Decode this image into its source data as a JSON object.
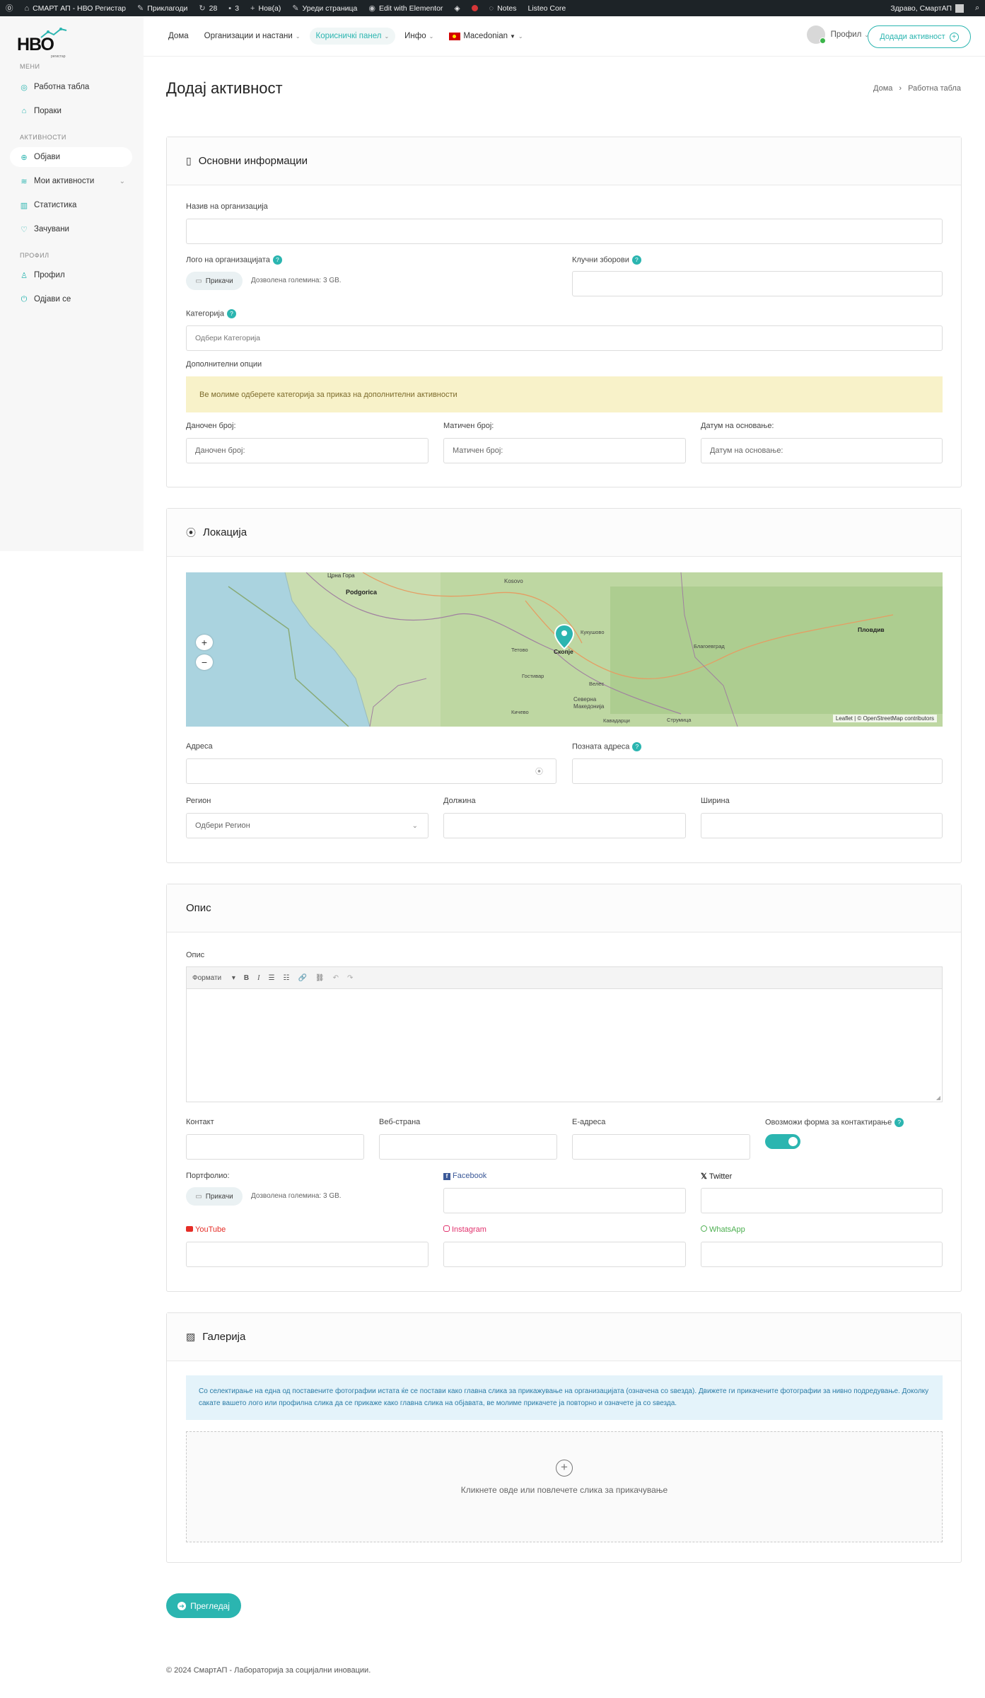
{
  "adminbar": {
    "site": "СМАРТ АП - НВО Регистар",
    "plugins": "Приклагоди",
    "updates": "28",
    "comments": "3",
    "new": "Нов(а)",
    "edit_page": "Уреди страница",
    "elementor": "Edit with Elementor",
    "notes": "Notes",
    "listeo": "Listeo Core",
    "greeting": "Здраво, СмартАП"
  },
  "logo": {
    "text": "НВО",
    "sub": "регистар"
  },
  "sidebar": {
    "sec_menu": "МЕНИ",
    "sec_activities": "АКТИВНОСТИ",
    "sec_profile": "ПРОФИЛ",
    "items": [
      {
        "label": "Работна табла"
      },
      {
        "label": "Пораки"
      },
      {
        "label": "Објави"
      },
      {
        "label": "Мои активности"
      },
      {
        "label": "Статистика"
      },
      {
        "label": "Зачувани"
      },
      {
        "label": "Профил"
      },
      {
        "label": "Одјави се"
      }
    ]
  },
  "topnav": {
    "items": [
      {
        "label": "Дома"
      },
      {
        "label": "Организации и настани"
      },
      {
        "label": "Корисничкi панел"
      },
      {
        "label": "Инфо"
      },
      {
        "label": "Macedonian"
      }
    ],
    "profile": "Профил",
    "add_button": "Додади активност"
  },
  "page": {
    "title": "Додај активност",
    "breadcrumb_home": "Дома",
    "breadcrumb_current": "Работна табла"
  },
  "basic": {
    "title": "Основни информации",
    "org_name_label": "Назив на организација",
    "logo_label": "Лого на организацијата",
    "attach": "Прикачи",
    "size_note": "Дозволена големина: 3 GB.",
    "keywords_label": "Клучни зборови",
    "category_label": "Категорија",
    "category_placeholder": "Одбери Категорија",
    "extra_label": "Дополнителни опции",
    "extra_warning": "Ве молиме одберете категорија за приказ на дополнителни активности",
    "tax_label": "Даночен број:",
    "tax_placeholder": "Даночен број:",
    "reg_label": "Матичен број:",
    "reg_placeholder": "Матичен број:",
    "date_label": "Датум на основање:",
    "date_placeholder": "Датум на основање:"
  },
  "location": {
    "title": "Локација",
    "zoom_in": "+",
    "zoom_out": "−",
    "attribution": "Leaflet | © OpenStreetMap contributors",
    "map_labels": [
      "Црна Гора",
      "Podgorica",
      "Kosovo",
      "Скопје",
      "Кукушово",
      "Пловдив",
      "Благоевград",
      "Северна Македонија",
      "Кавадарци",
      "Струмица",
      "Тетово",
      "Гостивар",
      "Велес",
      "Кичево"
    ],
    "address_label": "Адреса",
    "known_address_label": "Позната адреса",
    "region_label": "Регион",
    "region_placeholder": "Одбери Регион",
    "longitude_label": "Должина",
    "latitude_label": "Ширина"
  },
  "description": {
    "title": "Опис",
    "desc_label": "Опис",
    "formats": "Формати",
    "contact_label": "Контакт",
    "web_label": "Веб-страна",
    "email_label": "Е-адреса",
    "contact_form_label": "Овозможи форма за контактирање",
    "portfolio_label": "Портфолио:",
    "attach": "Прикачи",
    "size_note": "Дозволена големина: 3 GB.",
    "facebook": "Facebook",
    "twitter": "Twitter",
    "youtube": "YouTube",
    "instagram": "Instagram",
    "whatsapp": "WhatsApp"
  },
  "gallery": {
    "title": "Галерија",
    "info": "Со селектирање на една од поставените фотографии истата ќе се постави како главна слика за прикажување на организацијата (означена со ѕвезда). Движете ги прикачените фотографии за нивно подредување. Доколку сакате вашето лого или профилна слика да се прикаже како главна слика на објавата, ве молиме прикачете ја повторно и означете ја со ѕвезда.",
    "drop_text": "Кликнете овде или повлечете слика за прикачување"
  },
  "preview_button": "Прегледај",
  "footer": "© 2024 СмартАП - Лабораторија за социјални иновации.",
  "colors": {
    "accent": "#2bb5b0",
    "facebook": "#3b5998",
    "youtube": "#e52d27",
    "instagram": "#e1306c",
    "whatsapp": "#4caf50"
  }
}
